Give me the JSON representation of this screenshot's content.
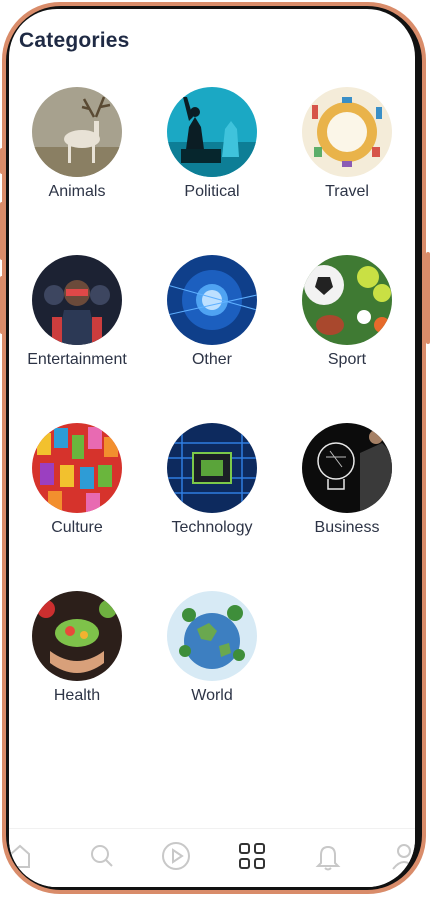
{
  "header": {
    "title": "Categories"
  },
  "categories": [
    {
      "label": "Animals"
    },
    {
      "label": "Political"
    },
    {
      "label": "Travel"
    },
    {
      "label": "Entertainment"
    },
    {
      "label": "Other"
    },
    {
      "label": "Sport"
    },
    {
      "label": "Culture"
    },
    {
      "label": "Technology"
    },
    {
      "label": "Business"
    },
    {
      "label": "Health"
    },
    {
      "label": "World"
    }
  ],
  "bottom_nav": {
    "items": [
      {
        "icon": "home-icon",
        "active": false
      },
      {
        "icon": "search-icon",
        "active": false
      },
      {
        "icon": "play-icon",
        "active": false
      },
      {
        "icon": "grid-icon",
        "active": true
      },
      {
        "icon": "bell-icon",
        "active": false
      },
      {
        "icon": "profile-icon",
        "active": false
      }
    ]
  },
  "colors": {
    "frame": "#d98c6a",
    "title": "#1f2a44",
    "label": "#2d3446",
    "nav_icon": "#c8c8c8",
    "nav_active": "#333333"
  }
}
